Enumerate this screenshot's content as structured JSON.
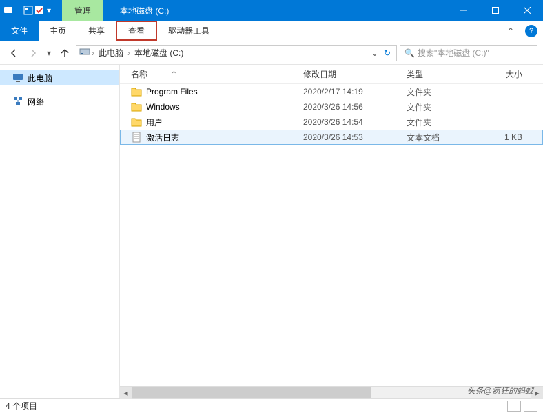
{
  "window": {
    "manage_label": "管理",
    "title": "本地磁盘 (C:)"
  },
  "ribbon": {
    "file": "文件",
    "home": "主页",
    "share": "共享",
    "view": "查看",
    "drive_tools": "驱动器工具"
  },
  "nav": {
    "crumbs": [
      "此电脑",
      "本地磁盘 (C:)"
    ],
    "search_placeholder": "搜索\"本地磁盘 (C:)\""
  },
  "sidebar": {
    "items": [
      {
        "label": "此电脑",
        "icon": "pc"
      },
      {
        "label": "网络",
        "icon": "network"
      }
    ]
  },
  "columns": {
    "name": "名称",
    "date": "修改日期",
    "type": "类型",
    "size": "大小"
  },
  "files": [
    {
      "name": "Program Files",
      "date": "2020/2/17 14:19",
      "type": "文件夹",
      "size": "",
      "icon": "folder",
      "selected": false
    },
    {
      "name": "Windows",
      "date": "2020/3/26 14:56",
      "type": "文件夹",
      "size": "",
      "icon": "folder",
      "selected": false
    },
    {
      "name": "用户",
      "date": "2020/3/26 14:54",
      "type": "文件夹",
      "size": "",
      "icon": "folder",
      "selected": false
    },
    {
      "name": "激活日志",
      "date": "2020/3/26 14:53",
      "type": "文本文档",
      "size": "1 KB",
      "icon": "text",
      "selected": true
    }
  ],
  "status": {
    "count": "4 个项目"
  },
  "watermark": {
    "pre": "头条",
    "at": "@",
    "name": "疯狂的蚂蚁"
  }
}
